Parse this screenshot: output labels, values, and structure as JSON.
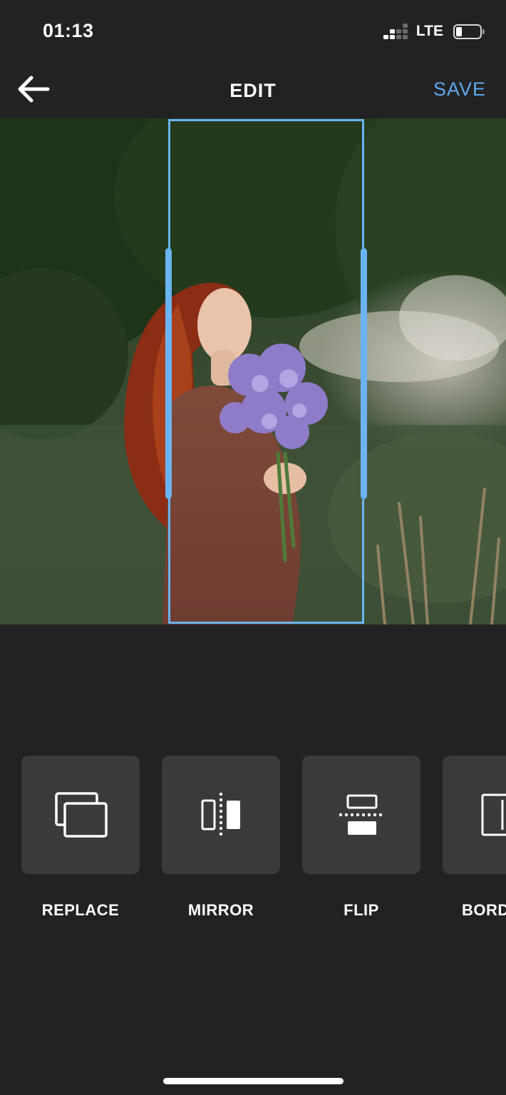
{
  "status_bar": {
    "time": "01:13",
    "network": "LTE",
    "signal_bars_active": 2,
    "battery_level": 0.25
  },
  "nav": {
    "back_icon": "arrow-left-icon",
    "title": "EDIT",
    "save_label": "SAVE",
    "accent_color": "#5ea8ec"
  },
  "photo": {
    "crop_color": "#6ab4f2"
  },
  "tools": [
    {
      "label": "REPLACE",
      "icon": "replace-icon"
    },
    {
      "label": "MIRROR",
      "icon": "mirror-icon"
    },
    {
      "label": "FLIP",
      "icon": "flip-icon"
    },
    {
      "label": "BORDER",
      "icon": "border-icon"
    }
  ]
}
